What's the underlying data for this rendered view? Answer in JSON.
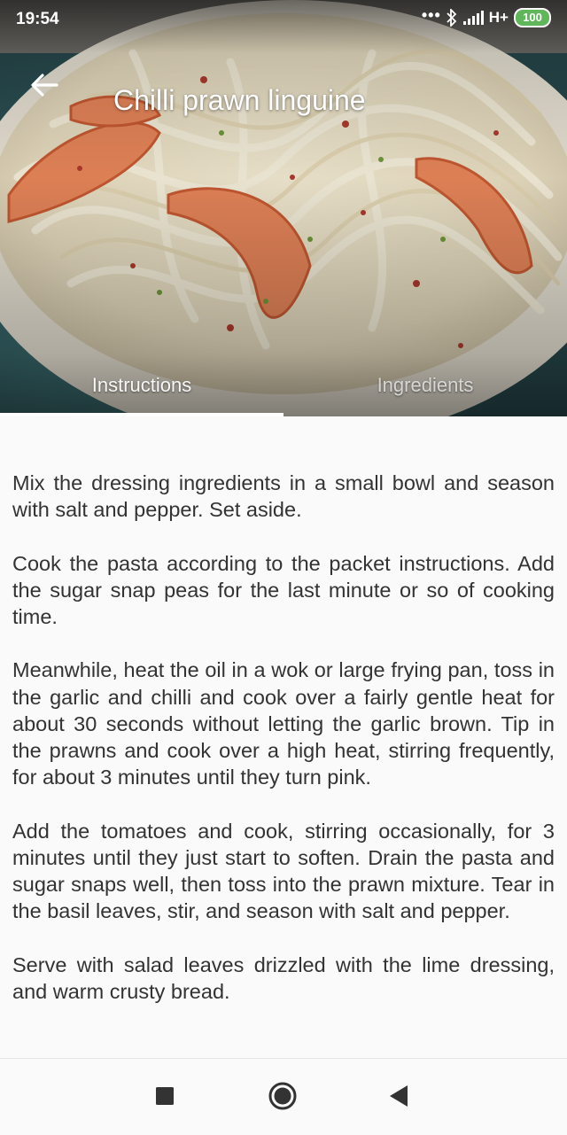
{
  "status_bar": {
    "time": "19:54",
    "dots": "•••",
    "network": "H+",
    "battery": "100",
    "icons": [
      "bluetooth-icon",
      "signal-icon",
      "battery-icon"
    ]
  },
  "header": {
    "title": "Chilli prawn linguine",
    "back_icon": "arrow-left-icon"
  },
  "tabs": [
    {
      "label": "Instructions",
      "selected": true
    },
    {
      "label": "Ingredients",
      "selected": false
    }
  ],
  "instructions": [
    "Mix the dressing ingredients in a small bowl and season with salt and pepper. Set aside.",
    "Cook the pasta according to the packet instructions. Add the sugar snap peas for the last minute or so of cooking time.",
    "Meanwhile, heat the oil in a wok or large frying pan, toss in the garlic and chilli and cook over a fairly gentle heat for about 30 seconds without letting the garlic brown. Tip in the prawns and cook over a high heat, stirring frequently, for about 3 minutes until they turn pink.",
    "Add the tomatoes and cook, stirring occasionally, for 3 minutes until they just start to soften. Drain the pasta and sugar snaps well, then toss into the prawn mixture. Tear in the basil leaves, stir, and season with salt and pepper.",
    "Serve with salad leaves drizzled with the lime dressing, and warm crusty bread."
  ],
  "nav_bar": {
    "icons": [
      "recent-apps-icon",
      "home-icon",
      "back-triangle-icon"
    ]
  },
  "colors": {
    "tab_indicator": "#ffffff",
    "content_text": "#333333",
    "background": "#fafafa",
    "battery": "#5fb75a"
  }
}
